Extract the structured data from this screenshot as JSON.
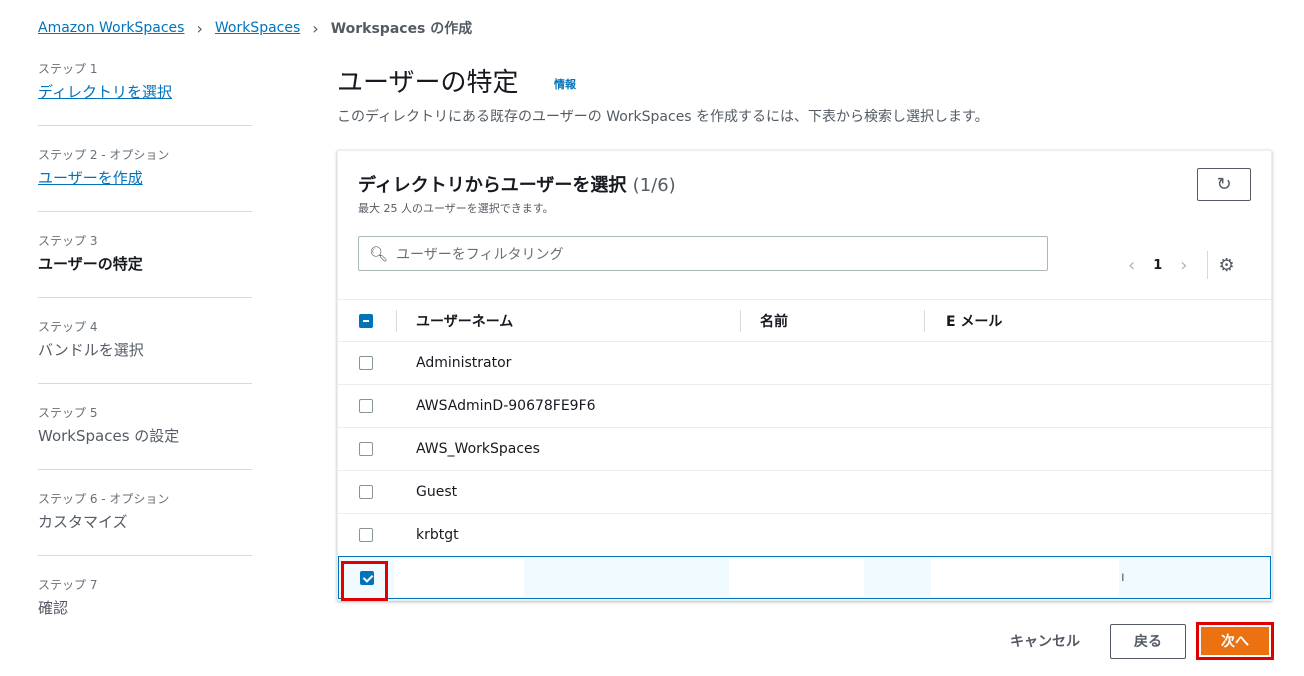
{
  "breadcrumb": {
    "items": [
      "Amazon WorkSpaces",
      "WorkSpaces"
    ],
    "current": "Workspaces の作成"
  },
  "steps": [
    {
      "num": "ステップ 1",
      "title": "ディレクトリを選択",
      "state": "link"
    },
    {
      "num": "ステップ 2 - オプション",
      "title": "ユーザーを作成",
      "state": "link"
    },
    {
      "num": "ステップ 3",
      "title": "ユーザーの特定",
      "state": "active"
    },
    {
      "num": "ステップ 4",
      "title": "バンドルを選択",
      "state": "disabled"
    },
    {
      "num": "ステップ 5",
      "title": "WorkSpaces の設定",
      "state": "disabled"
    },
    {
      "num": "ステップ 6 - オプション",
      "title": "カスタマイズ",
      "state": "disabled"
    },
    {
      "num": "ステップ 7",
      "title": "確認",
      "state": "disabled"
    }
  ],
  "page": {
    "title": "ユーザーの特定",
    "info": "情報",
    "description": "このディレクトリにある既存のユーザーの WorkSpaces を作成するには、下表から検索し選択します。"
  },
  "panel": {
    "title": "ディレクトリからユーザーを選択",
    "count": "(1/6)",
    "subtitle": "最大 25 人のユーザーを選択できます。",
    "refresh_icon": "refresh-icon",
    "search_placeholder": "ユーザーをフィルタリング",
    "page_number": "1"
  },
  "table": {
    "headers": {
      "username": "ユーザーネーム",
      "name": "名前",
      "email": "E メール"
    },
    "rows": [
      {
        "username": "Administrator",
        "checked": false
      },
      {
        "username": "AWSAdminD-90678FE9F6",
        "checked": false
      },
      {
        "username": "AWS_WorkSpaces",
        "checked": false
      },
      {
        "username": "Guest",
        "checked": false
      },
      {
        "username": "krbtgt",
        "checked": false
      },
      {
        "username": "",
        "checked": true,
        "email_trailing": "ı"
      }
    ]
  },
  "footer": {
    "cancel": "キャンセル",
    "back": "戻る",
    "next": "次へ"
  },
  "colors": {
    "link": "#0073bb",
    "primary": "#ec7211",
    "highlight": "#e00000"
  }
}
